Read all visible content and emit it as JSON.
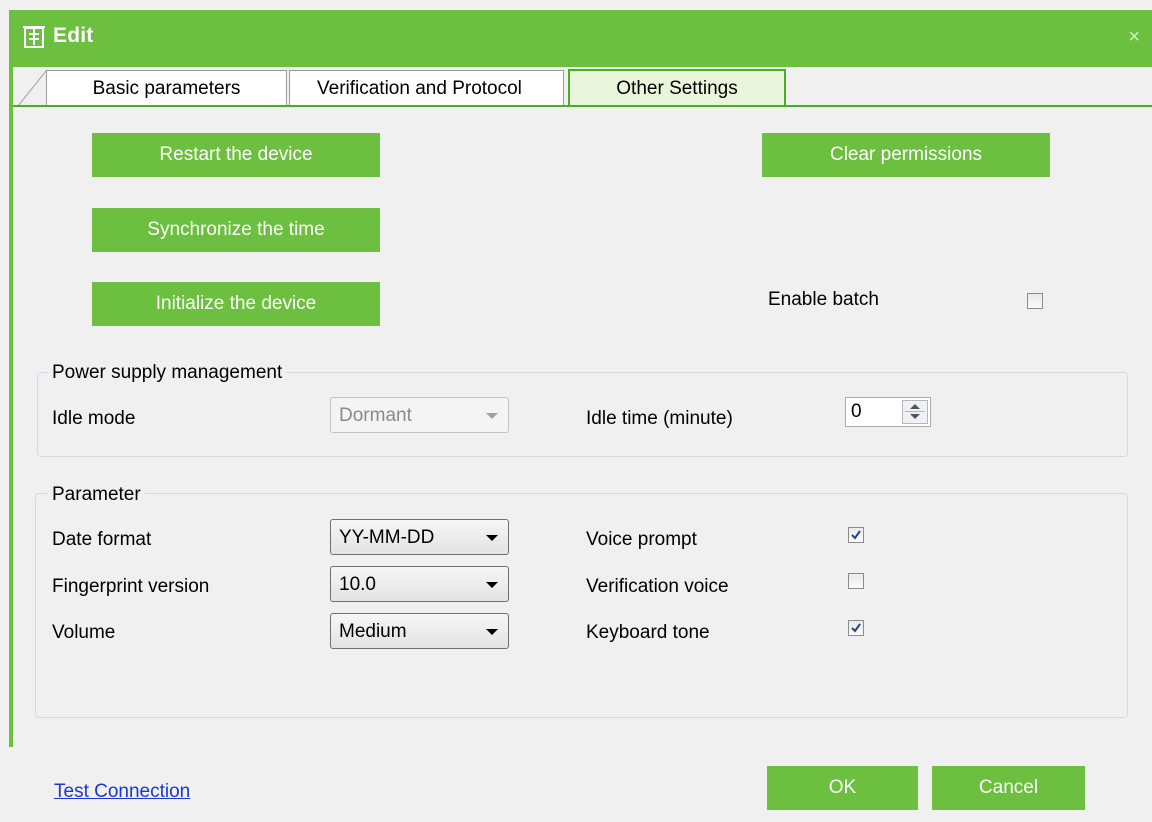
{
  "window": {
    "title": "Edit",
    "close_glyph": "×",
    "accent_color": "#6cbf3f"
  },
  "tabs": [
    {
      "label": "Basic parameters"
    },
    {
      "label": "Verification and Protocol"
    },
    {
      "label": "Other Settings",
      "active": true
    }
  ],
  "actions": {
    "restart": "Restart the device",
    "sync_time": "Synchronize the time",
    "initialize": "Initialize the device",
    "clear_permissions": "Clear permissions"
  },
  "enable_batch": {
    "label": "Enable batch",
    "checked": false
  },
  "power": {
    "title": "Power supply management",
    "idle_mode_label": "Idle mode",
    "idle_mode_value": "Dormant",
    "idle_time_label": "Idle time (minute)",
    "idle_time_value": "0"
  },
  "parameter": {
    "title": "Parameter",
    "date_format_label": "Date format",
    "date_format_value": "YY-MM-DD",
    "fp_version_label": "Fingerprint version",
    "fp_version_value": "10.0",
    "volume_label": "Volume",
    "volume_value": "Medium",
    "voice_prompt_label": "Voice prompt",
    "voice_prompt_checked": true,
    "verification_voice_label": "Verification voice",
    "verification_voice_checked": false,
    "keyboard_tone_label": "Keyboard tone",
    "keyboard_tone_checked": true
  },
  "footer": {
    "test_connection": "Test Connection",
    "ok": "OK",
    "cancel": "Cancel"
  }
}
